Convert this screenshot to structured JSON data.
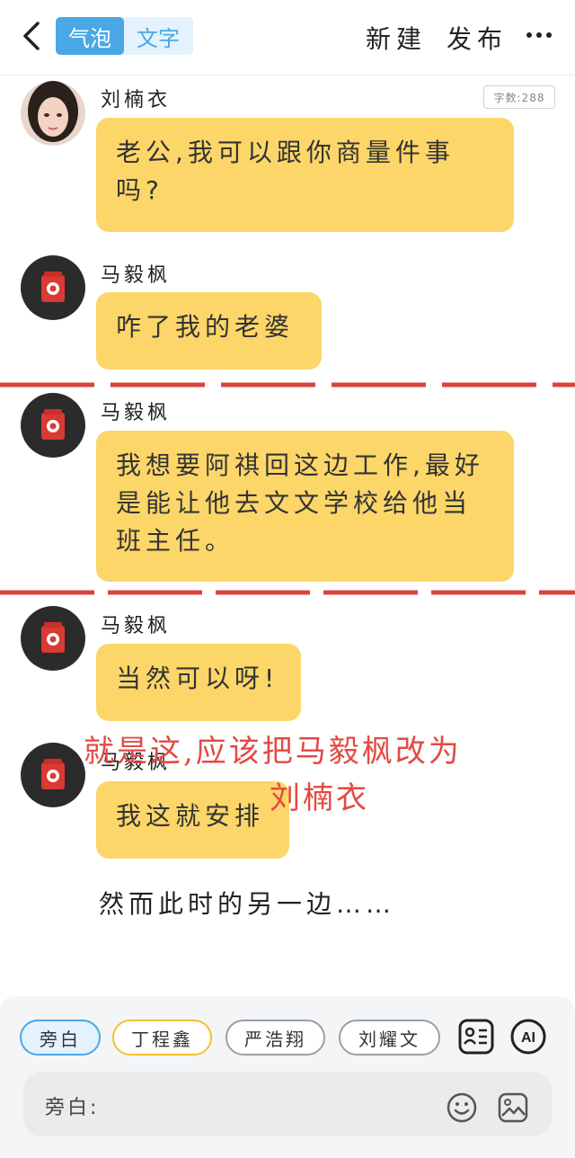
{
  "header": {
    "mode_bubble": "气泡",
    "mode_text": "文字",
    "new_label": "新建",
    "publish_label": "发布"
  },
  "word_count": "字数:288",
  "messages": [
    {
      "speaker": "刘楠衣",
      "text": "老公,我可以跟你商量件事吗?"
    },
    {
      "speaker": "马毅枫",
      "text": "咋了我的老婆"
    },
    {
      "speaker": "马毅枫",
      "text": "我想要阿祺回这边工作,最好是能让他去文文学校给他当班主任。"
    },
    {
      "speaker": "马毅枫",
      "text": "当然可以呀!"
    },
    {
      "speaker": "马毅枫",
      "text": "我这就安排"
    }
  ],
  "narration_text": "然而此时的另一边……",
  "annotation": {
    "line1": "就是这,应该把马毅枫改为",
    "line2": "刘楠衣",
    "color": "#e24a44"
  },
  "chips": [
    "旁白",
    "丁程鑫",
    "严浩翔",
    "刘耀文"
  ],
  "input": {
    "label": "旁白:",
    "value": ""
  },
  "icons": {
    "back": "chevron-left-icon",
    "more": "more-dots-icon",
    "contact_card": "contact-card-icon",
    "ai": "ai-icon",
    "emoji": "emoji-icon",
    "image": "image-icon"
  },
  "colors": {
    "accent_blue": "#4aa8e6",
    "bubble_yellow": "#fcd669",
    "dash_red": "#d9443f"
  }
}
